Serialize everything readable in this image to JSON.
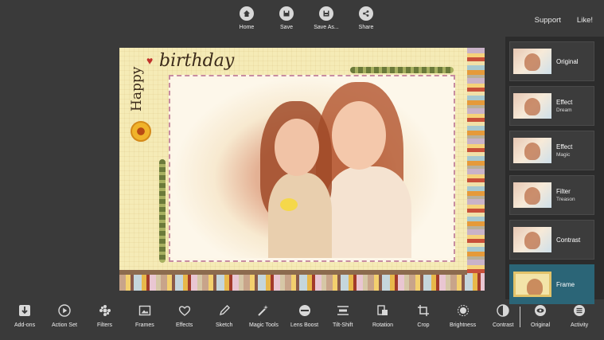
{
  "top_toolbar": {
    "home": "Home",
    "save": "Save",
    "save_as": "Save As...",
    "share": "Share"
  },
  "top_links": {
    "support": "Support",
    "like": "Like!"
  },
  "canvas": {
    "happy": "Happy",
    "birthday": "birthday"
  },
  "side_panel": {
    "items": [
      {
        "title": "Original",
        "subtitle": ""
      },
      {
        "title": "Effect",
        "subtitle": "Dream"
      },
      {
        "title": "Effect",
        "subtitle": "Magic"
      },
      {
        "title": "Filter",
        "subtitle": "Treason"
      },
      {
        "title": "Contrast",
        "subtitle": ""
      },
      {
        "title": "Frame",
        "subtitle": ""
      }
    ],
    "active_index": 5
  },
  "bottom_toolbar": {
    "add_ons": "Add-ons",
    "action_set": "Action Set",
    "filters": "Filters",
    "frames": "Frames",
    "effects": "Effects",
    "sketch": "Sketch",
    "magic_tools": "Magic Tools",
    "lens_boost": "Lens Boost",
    "tilt_shift": "Tilt-Shift",
    "rotation": "Rotation",
    "crop": "Crop",
    "brightness": "Brightness",
    "contrast": "Contrast",
    "original": "Original",
    "activity": "Activity"
  },
  "colors": {
    "background": "#3a3a3a",
    "active_item": "#2b6577"
  }
}
